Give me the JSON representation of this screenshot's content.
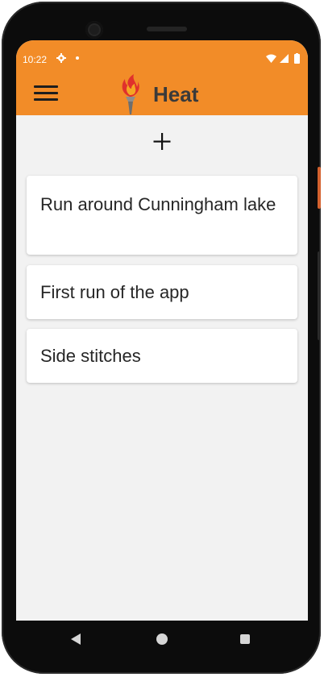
{
  "status_bar": {
    "time": "10:22",
    "icons": [
      "gear-icon",
      "dot-icon",
      "wifi-icon",
      "signal-icon",
      "battery-icon"
    ]
  },
  "app_bar": {
    "title": "Heat",
    "menu_icon": "hamburger-menu-icon",
    "logo_icon": "torch-flame-icon",
    "color": "#f28c28"
  },
  "toolbar": {
    "add_icon": "plus-icon"
  },
  "runs": [
    {
      "title": "Run around Cunningham lake"
    },
    {
      "title": "First run of the app"
    },
    {
      "title": "Side stitches"
    }
  ],
  "nav_bar": {
    "icons": [
      "back-icon",
      "home-icon",
      "recents-icon"
    ]
  }
}
